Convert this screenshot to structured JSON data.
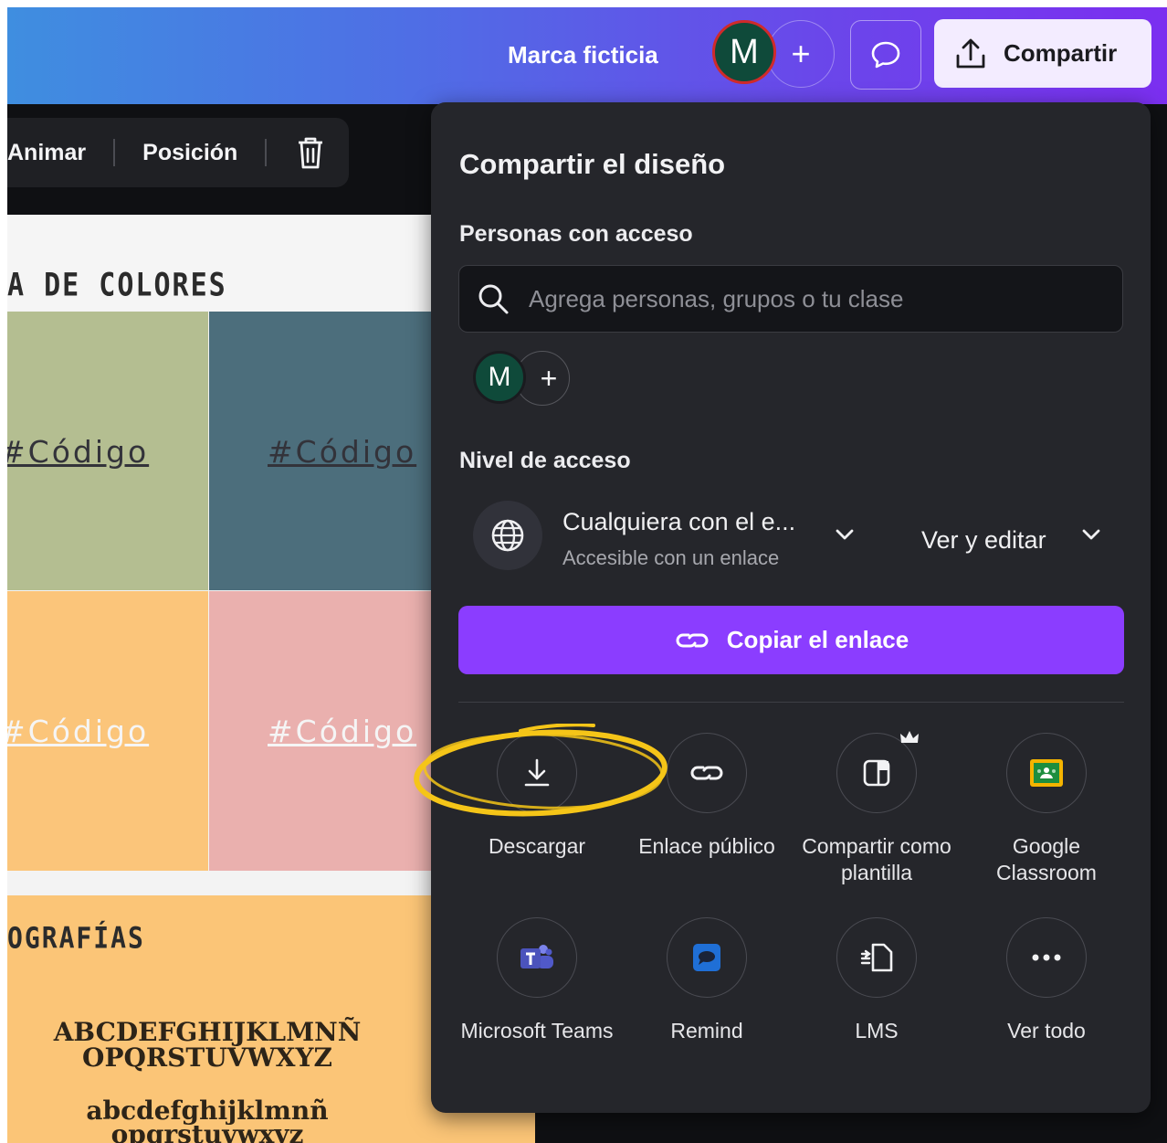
{
  "header": {
    "brand_name": "Marca ficticia",
    "avatar_initial": "M",
    "add_symbol": "+",
    "share_label": "Compartir"
  },
  "toolbar": {
    "animate_label": "Animar",
    "position_label": "Posición"
  },
  "canvas": {
    "palette_title": "A DE COLORES",
    "swatches": [
      {
        "code": "#Código",
        "color": "#b4be91"
      },
      {
        "code": "#Código",
        "color": "#4c6e7c"
      },
      {
        "code": "#Código",
        "color": "#fbc57a"
      },
      {
        "code": "#Código",
        "color": "#eab0ae"
      }
    ],
    "typography_title": "OGRAFÍAS",
    "typography_lines": [
      "ABCDEFGHIJKLMNÑ",
      "OPQRSTUVWXYZ",
      "abcdefghijklmnñ",
      "opqrstuvwxyz"
    ]
  },
  "share_panel": {
    "title": "Compartir el diseño",
    "people_label": "Personas con acceso",
    "search_placeholder": "Agrega personas, grupos o tu clase",
    "avatar_initial": "M",
    "add_symbol": "+",
    "access_level_label": "Nivel de acceso",
    "access_main": "Cualquiera con el e...",
    "access_sub": "Accesible con un enlace",
    "permission": "Ver y editar",
    "copy_link_label": "Copiar el enlace",
    "options": [
      {
        "label": "Descargar",
        "icon": "download-icon"
      },
      {
        "label": "Enlace público",
        "icon": "link-icon"
      },
      {
        "label": "Compartir como plantilla",
        "icon": "template-icon"
      },
      {
        "label": "Google Classroom",
        "icon": "google-classroom-icon"
      },
      {
        "label": "Microsoft Teams",
        "icon": "microsoft-teams-icon"
      },
      {
        "label": "Remind",
        "icon": "remind-icon"
      },
      {
        "label": "LMS",
        "icon": "lms-icon"
      },
      {
        "label": "Ver todo",
        "icon": "more-icon"
      }
    ]
  },
  "colors": {
    "accent": "#8b3dff",
    "panel_bg": "#25262b",
    "highlight": "#f5c518"
  }
}
